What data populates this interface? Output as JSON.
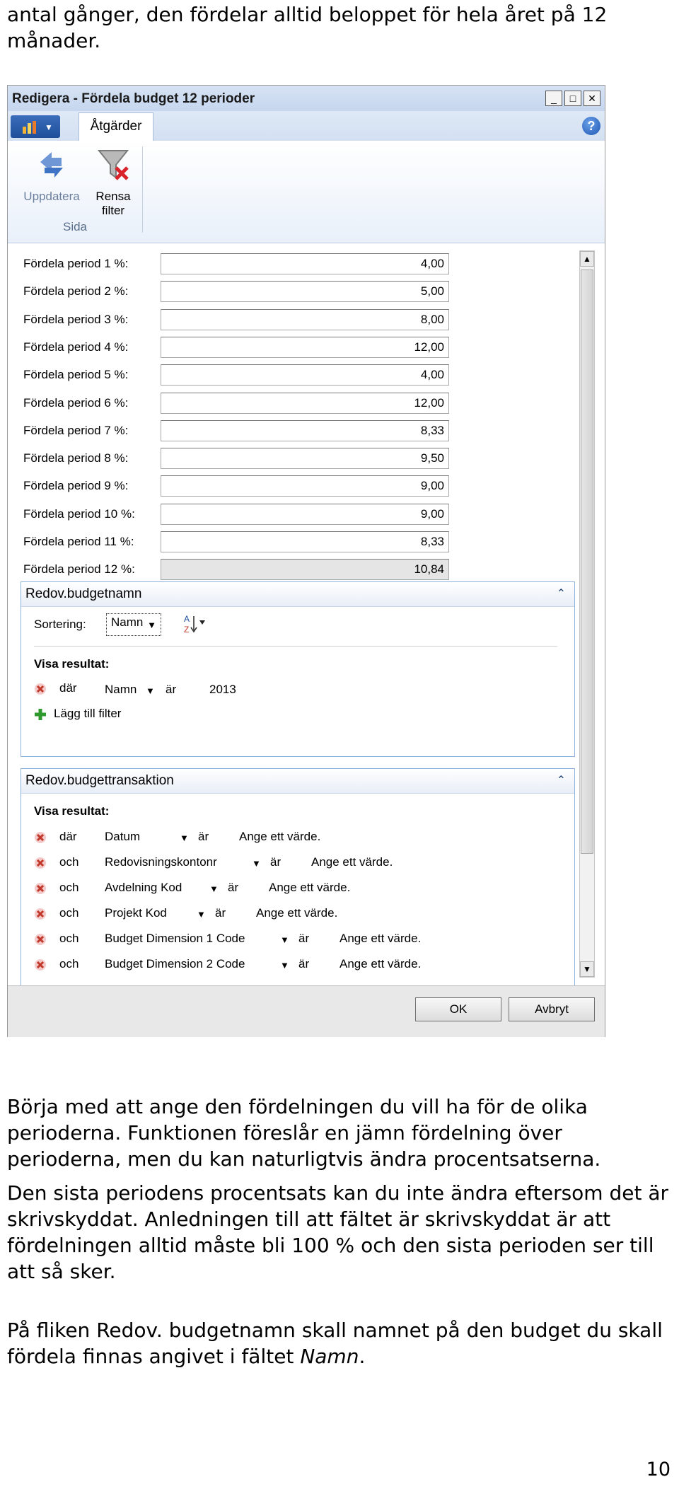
{
  "doc": {
    "intro": "antal gånger, den fördelar alltid beloppet för hela året på 12 månader.",
    "para1": "Börja med att ange den fördelningen du vill ha för de olika perioderna. Funktionen föreslår en jämn fördelning över perioderna, men du kan naturligtvis ändra procentsatserna.",
    "para2": "Den sista periodens procentsats kan du inte ändra eftersom det är skrivskyddat. Anledningen till att fältet är skrivskyddat är att fördelningen alltid måste bli 100 % och den sista perioden ser till att så sker.",
    "para3_text": "På fliken Redov. budgetnamn skall namnet på den budget du skall fördela finnas angivet i fältet ",
    "para3_em": "Namn",
    "para3_end": ".",
    "page_number": "10"
  },
  "window": {
    "title": "Redigera - Fördela budget 12 perioder",
    "tab_label": "Åtgärder",
    "help": "?",
    "ribbon": {
      "update_label": "Uppdatera",
      "clear_filter_label_1": "Rensa",
      "clear_filter_label_2": "filter",
      "group_label": "Sida"
    },
    "periods": [
      {
        "label": "Fördela period 1 %:",
        "value": "4,00"
      },
      {
        "label": "Fördela period 2 %:",
        "value": "5,00"
      },
      {
        "label": "Fördela period 3 %:",
        "value": "8,00"
      },
      {
        "label": "Fördela period 4 %:",
        "value": "12,00"
      },
      {
        "label": "Fördela period 5 %:",
        "value": "4,00"
      },
      {
        "label": "Fördela period 6 %:",
        "value": "12,00"
      },
      {
        "label": "Fördela period 7 %:",
        "value": "8,33"
      },
      {
        "label": "Fördela period 8 %:",
        "value": "9,50"
      },
      {
        "label": "Fördela period 9 %:",
        "value": "9,00"
      },
      {
        "label": "Fördela period 10 %:",
        "value": "9,00"
      },
      {
        "label": "Fördela period 11 %:",
        "value": "8,33"
      },
      {
        "label": "Fördela period 12 %:",
        "value": "10,84"
      }
    ],
    "budget_name_tab": {
      "title": "Redov.budgetnamn",
      "sort_label": "Sortering:",
      "sort_value": "Namn",
      "show_results": "Visa resultat:",
      "filter": {
        "conj": "där",
        "field": "Namn",
        "op": "är",
        "value": "2013"
      },
      "add_filter": "Lägg till filter"
    },
    "budget_trans_tab": {
      "title": "Redov.budgettransaktion",
      "show_results": "Visa resultat:",
      "filters": [
        {
          "conj": "där",
          "field": "Datum",
          "op": "är",
          "value": "Ange ett värde."
        },
        {
          "conj": "och",
          "field": "Redovisningskontonr",
          "op": "är",
          "value": "Ange ett värde."
        },
        {
          "conj": "och",
          "field": "Avdelning Kod",
          "op": "är",
          "value": "Ange ett värde."
        },
        {
          "conj": "och",
          "field": "Projekt Kod",
          "op": "är",
          "value": "Ange ett värde."
        },
        {
          "conj": "och",
          "field": "Budget Dimension 1 Code",
          "op": "är",
          "value": "Ange ett värde."
        },
        {
          "conj": "och",
          "field": "Budget Dimension 2 Code",
          "op": "är",
          "value": "Ange ett värde."
        }
      ]
    },
    "ok_label": "OK",
    "cancel_label": "Avbryt"
  }
}
